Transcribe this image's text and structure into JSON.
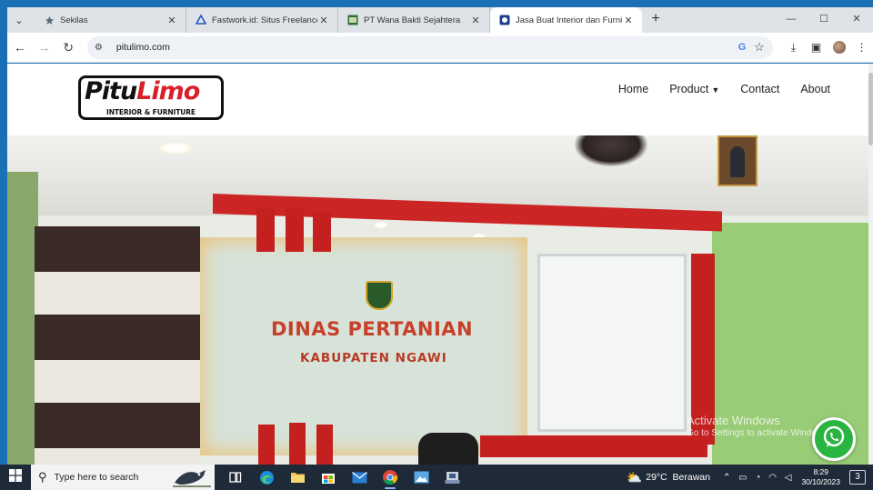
{
  "browser": {
    "tabs": [
      {
        "title": "Sekilas",
        "icon": "sekilas-icon",
        "active": false
      },
      {
        "title": "Fastwork.id: Situs Freelance Online",
        "icon": "fastwork-icon",
        "active": false
      },
      {
        "title": "PT Wana Bakti Sejahtera",
        "icon": "wana-bakti-icon",
        "active": false
      },
      {
        "title": "Jasa Buat Interior dan Furniture",
        "icon": "pitulimo-favicon",
        "active": true
      }
    ],
    "new_tab": "+",
    "address": "pitulimo.com"
  },
  "site": {
    "logo": {
      "text_dark": "Pitu",
      "text_red": "Limo",
      "tagline": "INTERIOR & FURNITURE"
    },
    "nav": [
      {
        "label": "Home"
      },
      {
        "label": "Product",
        "has_dropdown": true
      },
      {
        "label": "Contact"
      },
      {
        "label": "About"
      }
    ],
    "hero": {
      "sign_line1": "DINAS PERTANIAN",
      "sign_line2": "KABUPATEN NGAWI"
    },
    "whatsapp": {
      "icon": "whatsapp-icon",
      "color": "#2ab540"
    }
  },
  "windows_overlay": {
    "line1": "Activate Windows",
    "line2": "Go to Settings to activate Windows."
  },
  "taskbar": {
    "search_placeholder": "Type here to search",
    "apps": [
      "task-view-icon",
      "edge-icon",
      "file-explorer-icon",
      "store-icon",
      "mail-icon",
      "chrome-icon",
      "photos-icon",
      "app-icon"
    ],
    "weather": {
      "temp": "29°C",
      "condition": "Berawan"
    },
    "time": "8:29",
    "date": "30/10/2023",
    "notifications": "3"
  },
  "colors": {
    "brand_red": "#d8202a",
    "taskbar": "#1f2a38",
    "accent": "#1b6fb5"
  }
}
